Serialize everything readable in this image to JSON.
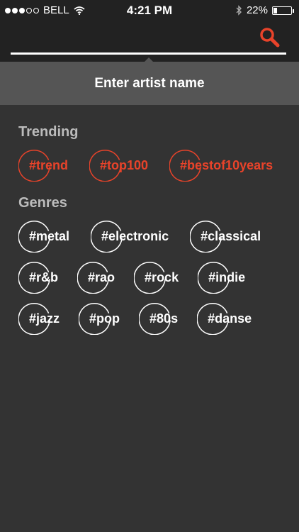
{
  "status_bar": {
    "carrier": "BELL",
    "time": "4:21 PM",
    "battery": "22%",
    "battery_level": 0.22
  },
  "search": {
    "value": "",
    "placeholder": "",
    "hint": "Enter artist name",
    "icon": "search-icon"
  },
  "colors": {
    "accent": "#e8432a",
    "background": "#333333",
    "header": "#222222",
    "hint_bar": "#555555"
  },
  "trending": {
    "title": "Trending",
    "tags": [
      "#trend",
      "#top100",
      "#bestof10years"
    ]
  },
  "genres": {
    "title": "Genres",
    "tags": [
      "#metal",
      "#electronic",
      "#classical",
      "#r&b",
      "#rao",
      "#rock",
      "#indie",
      "#jazz",
      "#pop",
      "#80s",
      "#danse"
    ]
  }
}
